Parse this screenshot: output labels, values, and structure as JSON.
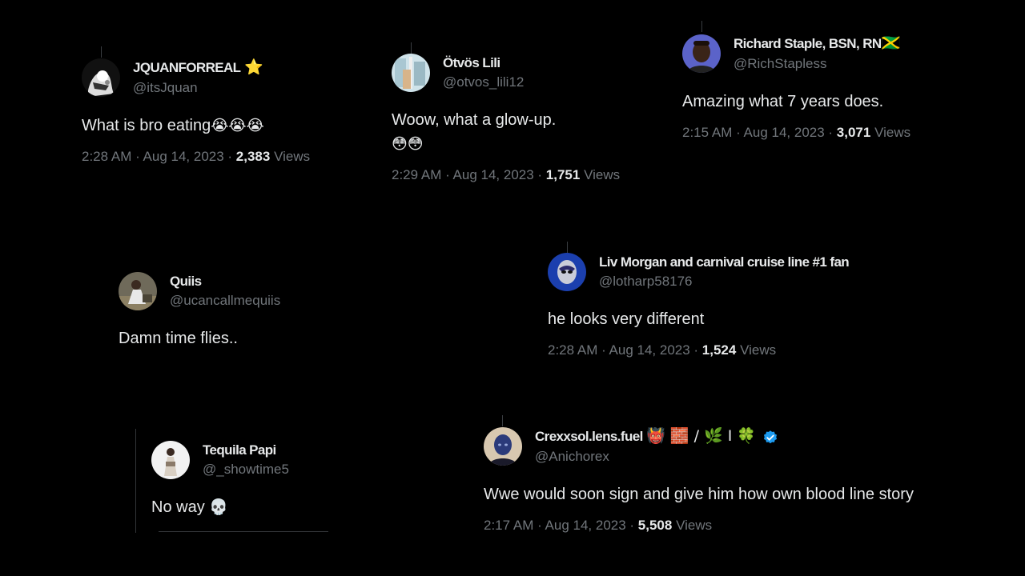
{
  "tweets": [
    {
      "display_name": "JQUANFORREAL",
      "name_suffix": "⭐",
      "handle": "@itsJquan",
      "text": "What is bro eating",
      "text_emoji": "😭😭😭",
      "time": "2:28 AM · Aug 14, 2023 · ",
      "views_count": "2,383",
      "views_label": " Views",
      "avatar": "avatar-bw-figure-icon"
    },
    {
      "display_name": "Ötvös Lili",
      "handle": "@otvos_lili12",
      "text": "Woow, what a glow-up.",
      "text_emoji": "😳😳",
      "time": "2:29 AM · Aug 14, 2023 · ",
      "views_count": "1,751",
      "views_label": " Views",
      "avatar": "avatar-window-icon"
    },
    {
      "display_name": "Richard Staple, BSN, RN",
      "name_suffix": "🇯🇲",
      "handle": "@RichStapless",
      "text": "Amazing what 7 years does.",
      "time": "2:15 AM · Aug 14, 2023 · ",
      "views_count": "3,071",
      "views_label": " Views",
      "avatar": "avatar-portrait-icon"
    },
    {
      "display_name": "Quiis",
      "handle": "@ucancallmequiis",
      "text": "Damn time flies..",
      "avatar": "avatar-outdoor-icon"
    },
    {
      "display_name": "Liv Morgan and carnival cruise line #1 fan",
      "handle": "@lotharp58176",
      "text": "he looks very different",
      "time": "2:28 AM · Aug 14, 2023 · ",
      "views_count": "1,524",
      "views_label": " Views",
      "avatar": "avatar-mask-icon"
    },
    {
      "display_name": "Tequila Papi",
      "handle": "@_showtime5",
      "text": "No way",
      "text_emoji": "💀",
      "avatar": "avatar-white-figure-icon"
    },
    {
      "display_name": "Crexxsol.lens.fuel",
      "name_suffix": "👹 🧱 / 🌿 I 🍀",
      "handle": "@Anichorex",
      "text": "Wwe would soon sign and give him how own blood line story",
      "time": "2:17 AM · Aug 14, 2023 · ",
      "views_count": "5,508",
      "views_label": " Views",
      "avatar": "avatar-blue-face-icon",
      "verified_color": "#1d9bf0"
    }
  ],
  "colors": {
    "background": "#000000",
    "primary_text": "#e7e9ea",
    "secondary_text": "#71767b"
  }
}
